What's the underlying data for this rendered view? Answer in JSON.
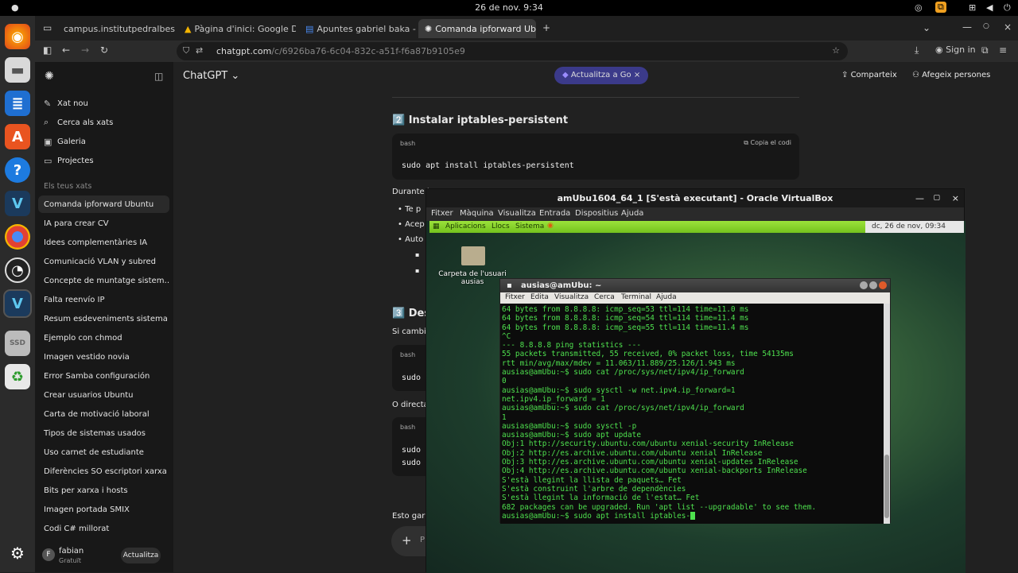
{
  "topbar": {
    "clock": "26 de nov.  9:34"
  },
  "browser": {
    "tabs": [
      {
        "label": "campus.institutpedralbes.cat"
      },
      {
        "label": "Pàgina d'inici: Google Drive"
      },
      {
        "label": "Apuntes gabriel baka - Doc"
      },
      {
        "label": "Comanda ipforward Ubuntu"
      }
    ],
    "url_domain": "chatgpt.com",
    "url_path": "/c/6926ba76-6c04-832c-a51f-f6a87b9105e9",
    "signin_label": "Sign in"
  },
  "sidebar": {
    "top_items": [
      {
        "label": "Xat nou",
        "icon": "edit-icon"
      },
      {
        "label": "Cerca als xats",
        "icon": "search-icon"
      },
      {
        "label": "Galeria",
        "icon": "image-icon"
      },
      {
        "label": "Projectes",
        "icon": "folder-icon"
      }
    ],
    "section_title": "Els teus xats",
    "chats": [
      "Comanda ipforward Ubuntu",
      "IA para crear CV",
      "Idees complementàries IA",
      "Comunicació VLAN y subred",
      "Concepte de muntatge sistem…",
      "Falta reenvío IP",
      "Resum esdeveniments sistema",
      "Ejemplo con chmod",
      "Imagen vestido novia",
      "Error Samba configuración",
      "Crear usuarios Ubuntu",
      "Carta de motivació laboral",
      "Tipos de sistemas usados",
      "Uso carnet de estudiante",
      "Diferències SO escriptori xarxa",
      "Bits per xarxa i hosts",
      "Imagen portada SMIX",
      "Codi C# millorat"
    ],
    "user_name": "fabian",
    "user_plan": "Gratuït",
    "user_initial": "F",
    "upgrade_label": "Actualitza"
  },
  "chat": {
    "model_label": "ChatGPT ⌄",
    "upgrade_pill": "Actualitza a Go",
    "share_label": "Comparteix",
    "add_people_label": "Afegeix persones",
    "heading2": "Instalar iptables-persistent",
    "heading2_num": "2️⃣",
    "code1_lang": "bash",
    "code1_copy": "Copia el codi",
    "code1_text": "sudo apt install iptables-persistent",
    "para_durante": "Durante l",
    "bullets": [
      "Te p",
      "Acep",
      "Auto"
    ],
    "heading3_num": "3️⃣",
    "heading3": "Des",
    "para_si": "Si cambia",
    "code2_lang": "bash",
    "code2_text": "sudo n",
    "para_o": "O directa",
    "code3_lang": "bash",
    "code3_lines": [
      "sudo i",
      "sudo i"
    ],
    "para_esto": "Esto gara",
    "input_placeholder": "P"
  },
  "vbox": {
    "title": "amUbu1604_64_1 [S'està executant] - Oracle VirtualBox",
    "menu": [
      "Fitxer",
      "Màquina",
      "Visualitza",
      "Entrada",
      "Dispositius",
      "Ajuda"
    ],
    "guest_panel": {
      "apps": "Aplicacions",
      "places": "Llocs",
      "system": "Sistema",
      "clock": "dc, 26 de nov, 09:34"
    },
    "desktop_icon_label": "Carpeta de l'usuari ausias",
    "terminal": {
      "title": "ausias@amUbu: ~",
      "menu": [
        "Fitxer",
        "Edita",
        "Visualitza",
        "Cerca",
        "Terminal",
        "Ajuda"
      ],
      "lines": [
        "64 bytes from 8.8.8.8: icmp_seq=53 ttl=114 time=11.0 ms",
        "64 bytes from 8.8.8.8: icmp_seq=54 ttl=114 time=11.4 ms",
        "64 bytes from 8.8.8.8: icmp_seq=55 ttl=114 time=11.4 ms",
        "^C",
        "--- 8.8.8.8 ping statistics ---",
        "55 packets transmitted, 55 received, 0% packet loss, time 54135ms",
        "rtt min/avg/max/mdev = 11.063/11.889/25.126/1.943 ms",
        "ausias@amUbu:~$ sudo cat /proc/sys/net/ipv4/ip_forward",
        "0",
        "ausias@amUbu:~$ sudo sysctl -w net.ipv4.ip_forward=1",
        "net.ipv4.ip_forward = 1",
        "ausias@amUbu:~$ sudo cat /proc/sys/net/ipv4/ip_forward",
        "1",
        "ausias@amUbu:~$ sudo sysctl -p",
        "ausias@amUbu:~$ sudo apt update",
        "Obj:1 http://security.ubuntu.com/ubuntu xenial-security InRelease",
        "Obj:2 http://es.archive.ubuntu.com/ubuntu xenial InRelease",
        "Obj:3 http://es.archive.ubuntu.com/ubuntu xenial-updates InRelease",
        "Obj:4 http://es.archive.ubuntu.com/ubuntu xenial-backports InRelease",
        "S'està llegint la llista de paquets… Fet",
        "S'està construint l'arbre de dependències",
        "S'està llegint la informació de l'estat… Fet",
        "682 packages can be upgraded. Run 'apt list --upgradable' to see them.",
        "ausias@amUbu:~$ sudo apt install iptables-"
      ]
    }
  },
  "colors": {
    "accent_pill": "#3b3a8a",
    "terminal_green": "#4ee04e",
    "guest_panel": "#8fd831"
  }
}
